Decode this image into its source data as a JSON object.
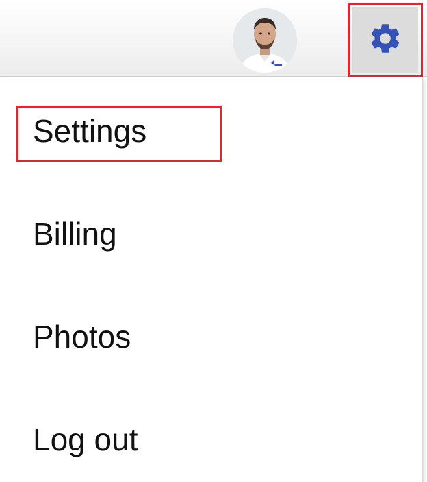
{
  "header": {
    "avatar_alt": "user avatar",
    "settings_icon": "gear-icon"
  },
  "menu": {
    "items": [
      {
        "label": "Settings"
      },
      {
        "label": "Billing"
      },
      {
        "label": "Photos"
      },
      {
        "label": "Log out"
      }
    ]
  },
  "colors": {
    "accent": "#3552b8",
    "highlight": "#e0262f"
  }
}
